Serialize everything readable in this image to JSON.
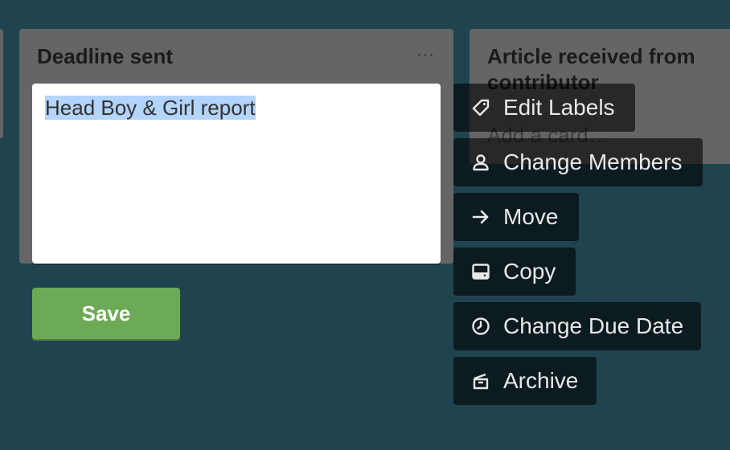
{
  "lists": {
    "deadline": {
      "title": "Deadline sent",
      "menu_label": "···"
    },
    "article": {
      "title": "Article received from contributor",
      "add_card_label": "Add a card…"
    }
  },
  "card_editor": {
    "text": "Head Boy & Girl report",
    "save_label": "Save"
  },
  "quick_actions": {
    "edit_labels": "Edit Labels",
    "change_members": "Change Members",
    "move": "Move",
    "copy": "Copy",
    "change_due_date": "Change Due Date",
    "archive": "Archive"
  },
  "colors": {
    "board_background": "#1f4450",
    "list_background": "#656565",
    "save_button": "#6daa56",
    "selection_highlight": "#b3d4fc"
  },
  "icons": {
    "edit_labels": "tag-icon",
    "change_members": "person-icon",
    "move": "arrow-right-icon",
    "copy": "card-icon",
    "change_due_date": "clock-icon",
    "archive": "archive-icon"
  }
}
